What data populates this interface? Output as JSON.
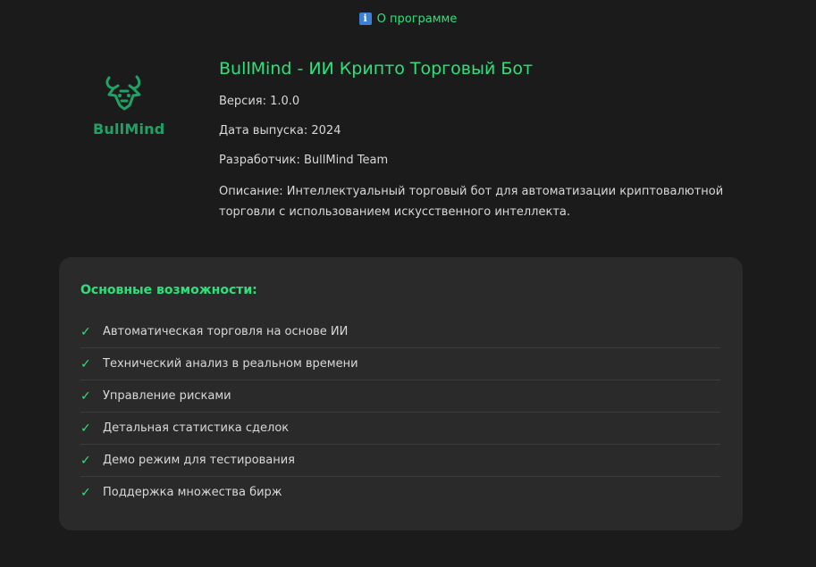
{
  "header": {
    "tab_label": "О программе",
    "icon": "info-icon"
  },
  "logo": {
    "text": "BullMind",
    "color": "#1fa266",
    "icon": "bull-head-icon"
  },
  "about": {
    "title": "BullMind - ИИ Крипто Торговый Бот",
    "version": "Версия: 1.0.0",
    "release_date": "Дата выпуска: 2024",
    "developer": "Разработчик: BullMind Team",
    "description": "Описание: Интеллектуальный торговый бот для автоматизации криптовалютной торговли с использованием искусственного интеллекта."
  },
  "features": {
    "title": "Основные возможности:",
    "check_icon": "✓",
    "items": [
      {
        "label": "Автоматическая торговля на основе ИИ"
      },
      {
        "label": "Технический анализ в реальном времени"
      },
      {
        "label": "Управление рисками"
      },
      {
        "label": "Детальная статистика сделок"
      },
      {
        "label": "Демо режим для тестирования"
      },
      {
        "label": "Поддержка множества бирж"
      }
    ]
  },
  "colors": {
    "accent": "#2fe07a",
    "background": "#1b1b1b",
    "card": "#2a2a2a",
    "text": "#d8d8d8"
  }
}
